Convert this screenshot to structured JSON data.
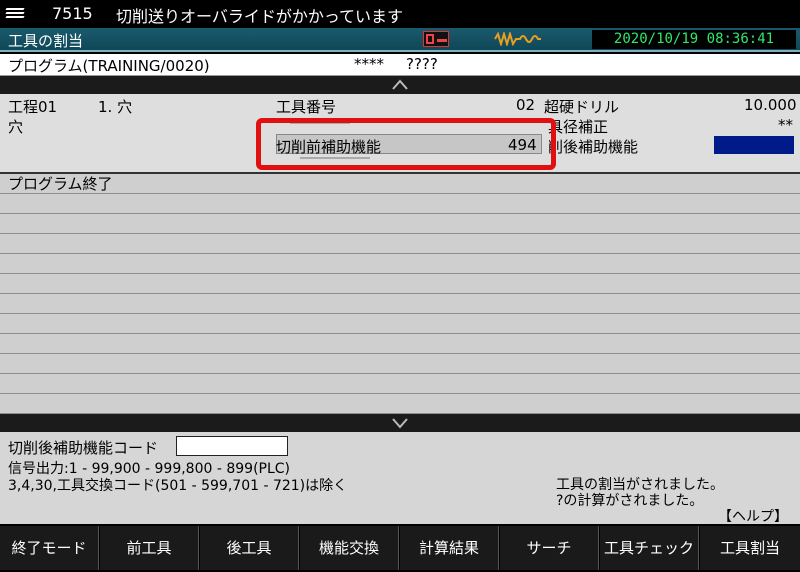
{
  "alarm": {
    "code": "7515",
    "message": "切削送りオーバライドがかかっています"
  },
  "header": {
    "title": "工具の割当",
    "datetime": "2020/10/19 08:36:41"
  },
  "program": {
    "name": "プログラム(TRAINING/0020)",
    "stars": "****",
    "question": "????"
  },
  "info": {
    "process_label": "工程01",
    "process_value": "1. 穴",
    "hole_label": "穴",
    "tool_number_label": "工具番号",
    "tool_number_value": "02",
    "tool_name": "超硬ドリル",
    "tool_diameter": "10.000",
    "diameter_comp_label": "具径補正",
    "diameter_comp_value": "**",
    "pre_cut_label": "切削前補助機能",
    "pre_cut_value": "494",
    "post_cut_label": "削後補助機能"
  },
  "list": {
    "rows": [
      "プログラム終了",
      "",
      "",
      "",
      "",
      "",
      "",
      "",
      "",
      "",
      "",
      ""
    ]
  },
  "lower": {
    "code_label": "切削後補助機能コード",
    "code_value": "",
    "signal_line": "信号出力:1 - 99,900 - 999,800 - 899(PLC)",
    "exclude_line": "3,4,30,工具交換コード(501 - 599,701 - 721)は除く",
    "message_1": "工具の割当がされました。",
    "message_2": "?の計算がされました。",
    "help_label": "【ヘルプ】"
  },
  "softkeys": [
    "終了モード",
    "前工具",
    "後工具",
    "機能交換",
    "計算結果",
    "サーチ",
    "工具チェック",
    "工具割当"
  ],
  "colors": {
    "title_bar": "#135060",
    "datetime_text": "#2ee86a",
    "highlight": "#e01010",
    "post_cut_field": "#001a8a"
  },
  "icons": {
    "alarm": "alarm-lines-icon",
    "status_1": "spindle-status-icon",
    "status_2": "waveform-icon"
  }
}
